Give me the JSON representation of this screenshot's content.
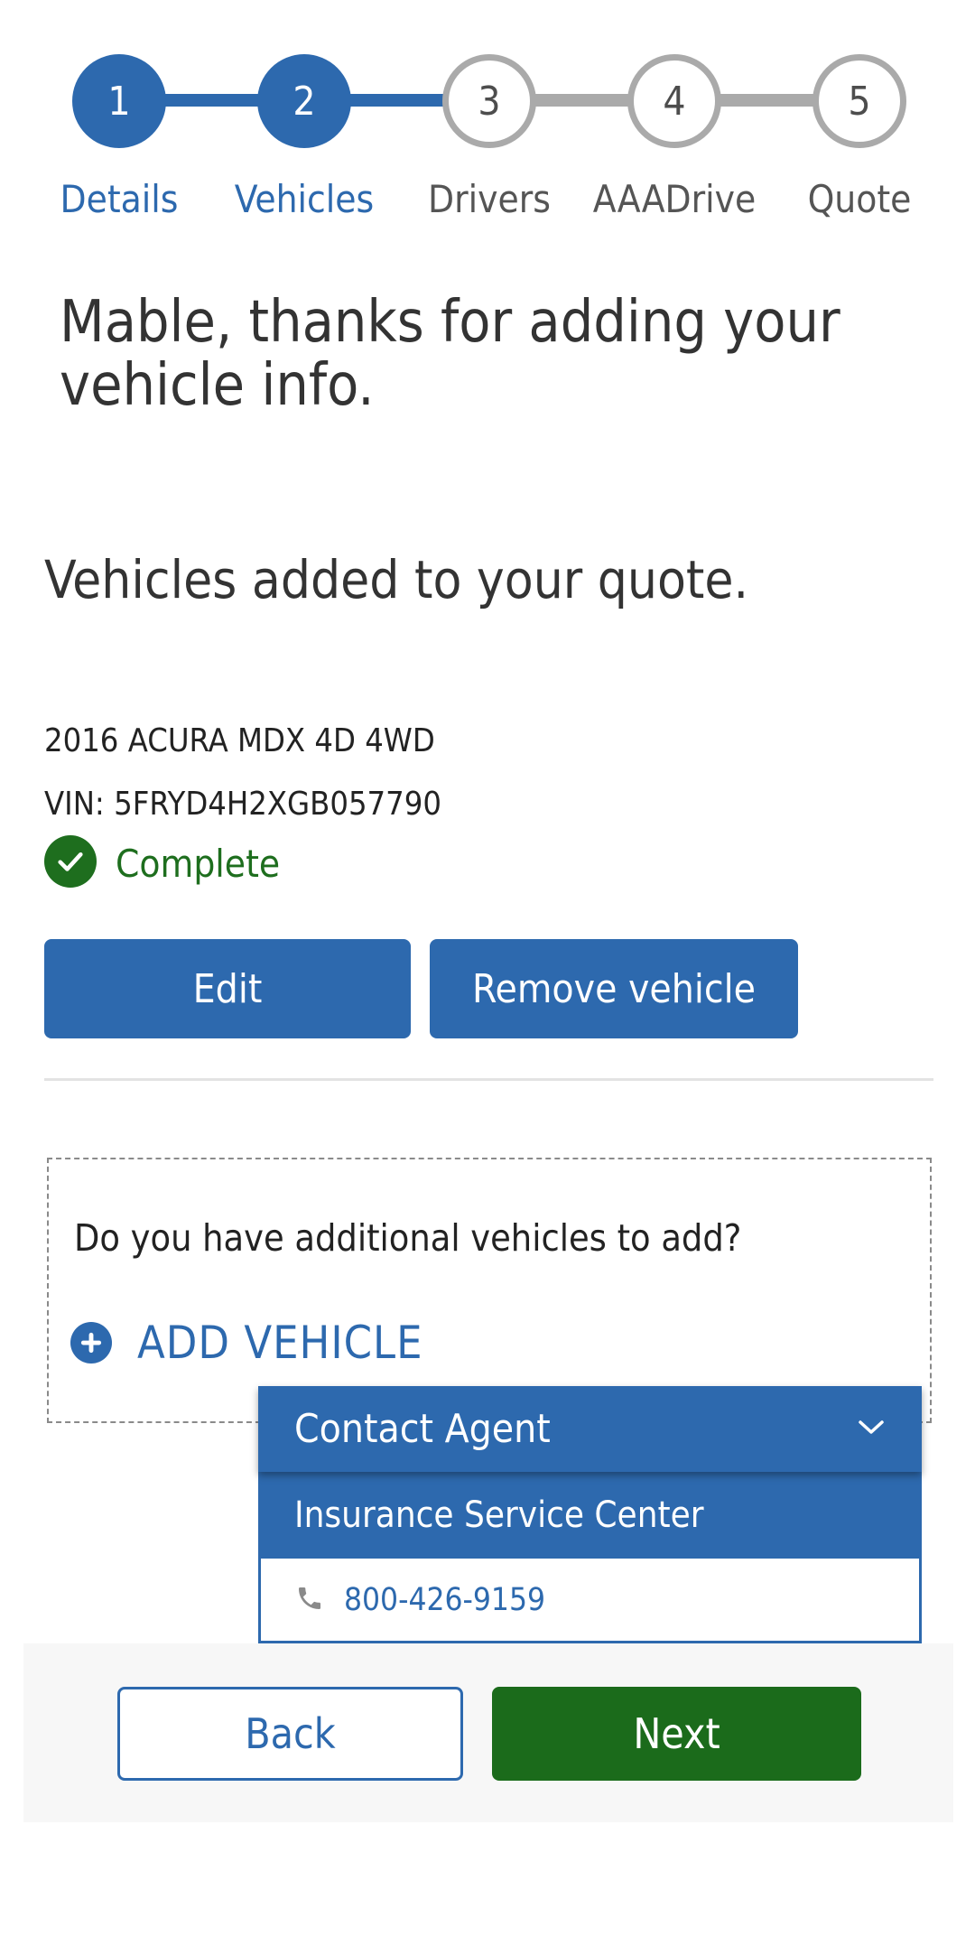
{
  "stepper": {
    "steps": [
      {
        "number": "1",
        "label": "Details",
        "state": "complete"
      },
      {
        "number": "2",
        "label": "Vehicles",
        "state": "current"
      },
      {
        "number": "3",
        "label": "Drivers",
        "state": "upcoming"
      },
      {
        "number": "4",
        "label": "AAADrive",
        "state": "upcoming"
      },
      {
        "number": "5",
        "label": "Quote",
        "state": "upcoming"
      }
    ]
  },
  "greeting": "Mable, thanks for adding your vehicle info.",
  "section_title": "Vehicles added to your quote.",
  "vehicle": {
    "name": "2016 ACURA MDX 4D 4WD",
    "vin": "VIN: 5FRYD4H2XGB057790",
    "status": "Complete",
    "status_icon": "check-circle-icon",
    "edit_label": "Edit",
    "remove_label": "Remove vehicle"
  },
  "add_vehicle": {
    "question": "Do you have additional vehicles to add?",
    "button_label": "ADD VEHICLE",
    "icon": "plus-circle-icon"
  },
  "contact_agent": {
    "title": "Contact Agent",
    "expanded": true,
    "service_center": "Insurance Service Center",
    "phone": "800-426-9159"
  },
  "footer": {
    "back_label": "Back",
    "next_label": "Next"
  },
  "colors": {
    "primary": "#2d69ae",
    "success": "#1e6e1e",
    "next_button": "#1b6b1b",
    "inactive_step": "#aaaaaa"
  }
}
